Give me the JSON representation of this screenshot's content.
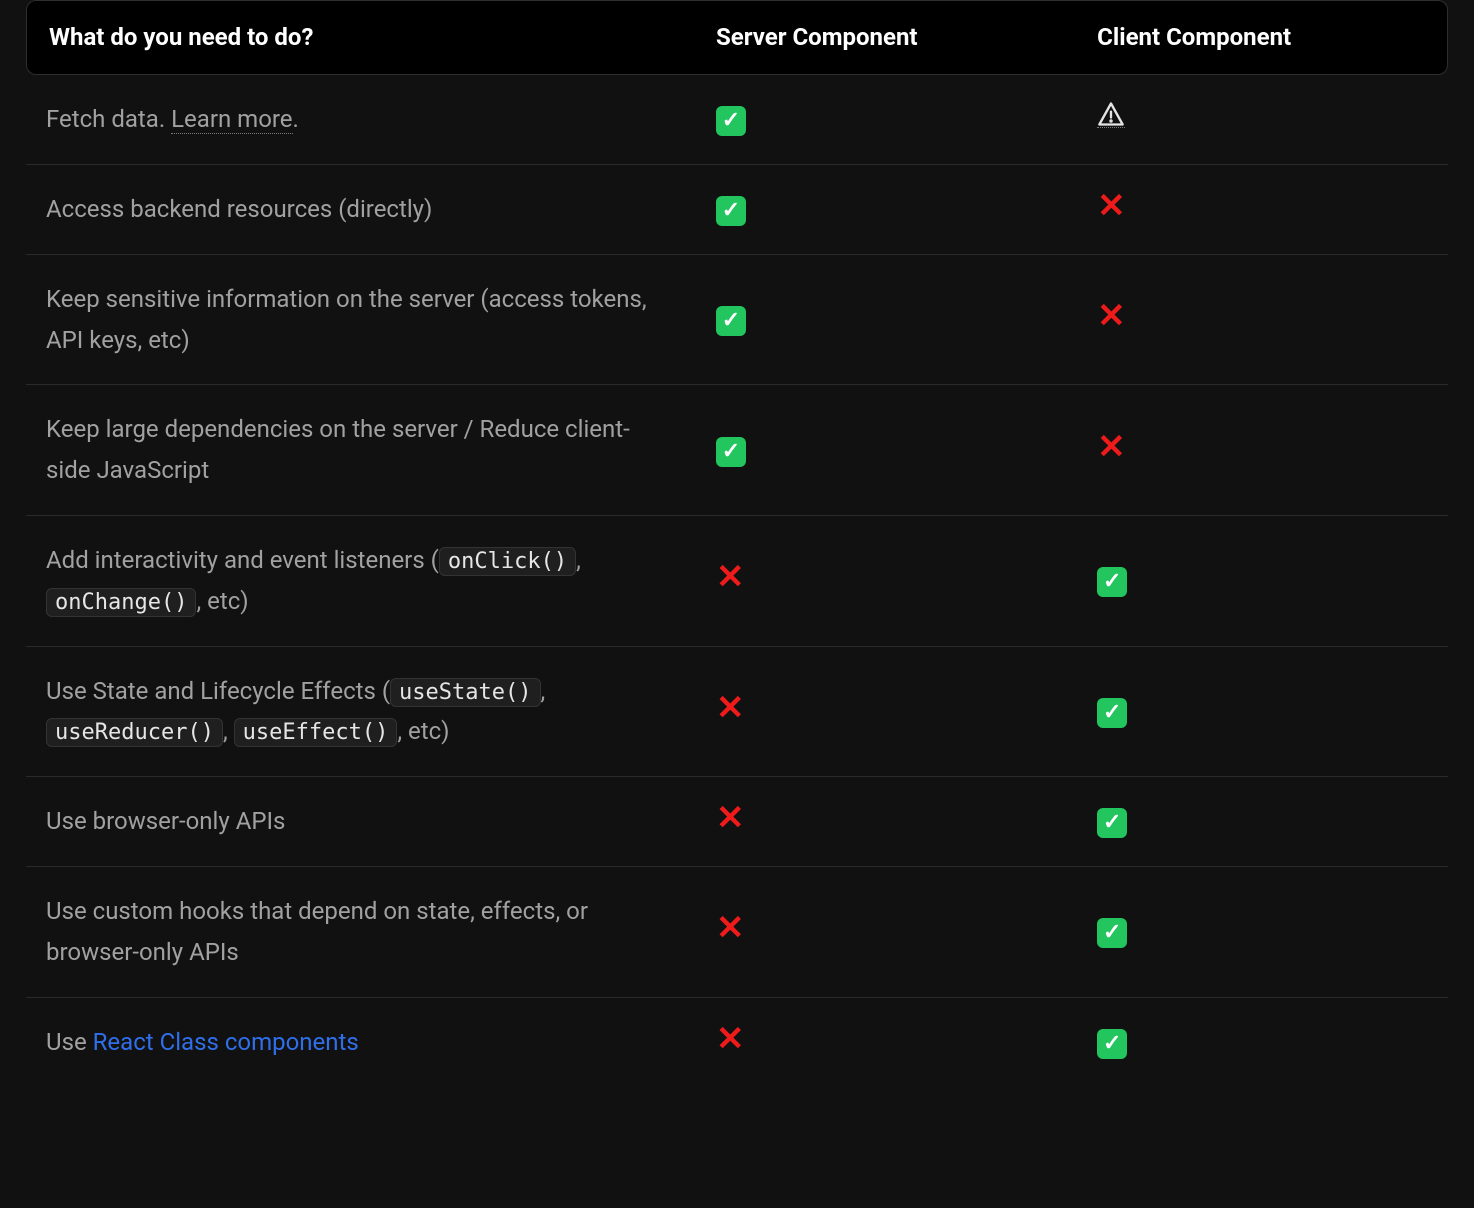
{
  "table": {
    "headers": {
      "what": "What do you need to do?",
      "server": "Server Component",
      "client": "Client Component"
    },
    "rows": [
      {
        "parts": [
          {
            "t": "text",
            "v": "Fetch data. "
          },
          {
            "t": "dotted-link",
            "v": "Learn more"
          },
          {
            "t": "text",
            "v": "."
          }
        ],
        "server": "check",
        "client": "warn"
      },
      {
        "parts": [
          {
            "t": "text",
            "v": "Access backend resources (directly)"
          }
        ],
        "server": "check",
        "client": "cross"
      },
      {
        "parts": [
          {
            "t": "text",
            "v": "Keep sensitive information on the server (access tokens, API keys, etc)"
          }
        ],
        "server": "check",
        "client": "cross"
      },
      {
        "parts": [
          {
            "t": "text",
            "v": "Keep large dependencies on the server / Reduce client-side JavaScript"
          }
        ],
        "server": "check",
        "client": "cross"
      },
      {
        "parts": [
          {
            "t": "text",
            "v": "Add interactivity and event listeners ("
          },
          {
            "t": "code",
            "v": "onClick()"
          },
          {
            "t": "text",
            "v": ", "
          },
          {
            "t": "code",
            "v": "onChange()"
          },
          {
            "t": "text",
            "v": ", etc)"
          }
        ],
        "server": "cross",
        "client": "check"
      },
      {
        "parts": [
          {
            "t": "text",
            "v": "Use State and Lifecycle Effects ("
          },
          {
            "t": "code",
            "v": "useState()"
          },
          {
            "t": "text",
            "v": ", "
          },
          {
            "t": "code",
            "v": "useReducer()"
          },
          {
            "t": "text",
            "v": ", "
          },
          {
            "t": "code",
            "v": "useEffect()"
          },
          {
            "t": "text",
            "v": ", etc)"
          }
        ],
        "server": "cross",
        "client": "check"
      },
      {
        "parts": [
          {
            "t": "text",
            "v": "Use browser-only APIs"
          }
        ],
        "server": "cross",
        "client": "check"
      },
      {
        "parts": [
          {
            "t": "text",
            "v": "Use custom hooks that depend on state, effects, or browser-only APIs"
          }
        ],
        "server": "cross",
        "client": "check"
      },
      {
        "parts": [
          {
            "t": "text",
            "v": "Use "
          },
          {
            "t": "blue-link",
            "v": "React Class components"
          }
        ],
        "server": "cross",
        "client": "check"
      }
    ]
  }
}
